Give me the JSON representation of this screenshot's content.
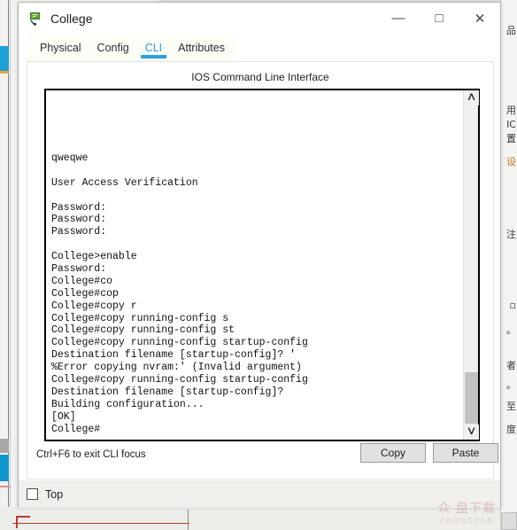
{
  "window": {
    "title": "College",
    "icon": "packet-tracer-device-icon",
    "controls": {
      "minimize": "—",
      "maximize": "□",
      "close": "✕"
    }
  },
  "tabs": [
    {
      "label": "Physical",
      "active": false
    },
    {
      "label": "Config",
      "active": false
    },
    {
      "label": "CLI",
      "active": true
    },
    {
      "label": "Attributes",
      "active": false
    }
  ],
  "panel": {
    "title": "IOS Command Line Interface"
  },
  "terminal": {
    "lines": [
      "qweqwe",
      "",
      "User Access Verification",
      "",
      "Password:",
      "Password:",
      "Password:",
      "",
      "College>enable",
      "Password:",
      "College#co",
      "College#cop",
      "College#copy r",
      "College#copy running-config s",
      "College#copy running-config st",
      "College#copy running-config startup-config",
      "Destination filename [startup-config]? '",
      "%Error copying nvram:' (Invalid argument)",
      "College#copy running-config startup-config",
      "Destination filename [startup-config]?",
      "Building configuration...",
      "[OK]",
      "College#"
    ],
    "scrollbar": {
      "up_arrow": "˄",
      "down_arrow": "˅"
    }
  },
  "footer": {
    "hint": "Ctrl+F6 to exit CLI focus",
    "copy_label": "Copy",
    "paste_label": "Paste"
  },
  "bottom": {
    "top_checkbox_label": "Top",
    "top_checked": false
  },
  "annotation": {
    "arrow_color": "#d42b1e",
    "direction": "left"
  },
  "watermark": {
    "text": "众 盘下载",
    "sub": "ZHONGPAN"
  },
  "background": {
    "right_column_text": [
      "品",
      "用",
      "IC",
      "置",
      "设",
      "注",
      "▫",
      "。",
      "者",
      "。",
      "至",
      "度"
    ]
  },
  "colors": {
    "accent": "#29a3dc",
    "terminal_text": "#111111",
    "window_bg": "#ffffff",
    "panel_bg": "#efefec",
    "button_face": "#e1e1e1"
  }
}
